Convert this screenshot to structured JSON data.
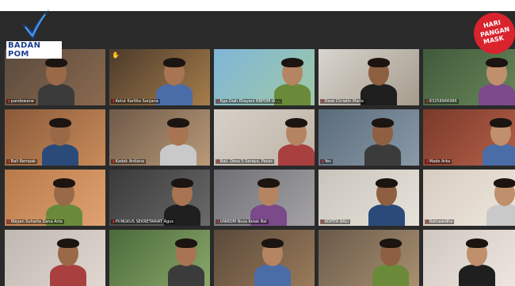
{
  "branding": {
    "logo_text": "BADAN POM",
    "campaign_badge": [
      "HARI",
      "PANGAN",
      "MASK"
    ]
  },
  "colors": {
    "logo_blue": "#1f3f8f",
    "badge_red": "#d9232d",
    "active_speaker": "#c7d94a",
    "mic_muted": "#e02b2b"
  },
  "participants": [
    {
      "label": "pandewane",
      "hand": true
    },
    {
      "label": "Ketut Kartika Sanjana",
      "hand": true
    },
    {
      "label": "Ega Diah Ekayani BBPOM di ...",
      "hand": false
    },
    {
      "label": "Dewi Chriatin Maria",
      "hand": false,
      "active": true
    },
    {
      "label": "83258966986",
      "hand": false
    },
    {
      "label": "Bali Rempak",
      "hand": false
    },
    {
      "label": "Kadek Ardiana",
      "hand": false
    },
    {
      "label": "Bali, Desa S Seraya, Pesas",
      "hand": false
    },
    {
      "label": "Yes",
      "hand": false
    },
    {
      "label": "Made Arka",
      "hand": false
    },
    {
      "label": "Wayan Suharta Dana Arta",
      "hand": false
    },
    {
      "label": "PUNGKUS SEKRETARIAT Agus",
      "hand": false
    },
    {
      "label": "UNIKOM Nusa Kelak Bal",
      "hand": false
    },
    {
      "label": "KOPITA BALI",
      "hand": false
    },
    {
      "label": "Ratnawidha",
      "hand": false
    },
    {
      "label": "",
      "hand": false
    },
    {
      "label": "",
      "hand": false
    },
    {
      "label": "",
      "hand": false
    },
    {
      "label": "",
      "hand": false
    },
    {
      "label": "",
      "hand": false
    }
  ]
}
